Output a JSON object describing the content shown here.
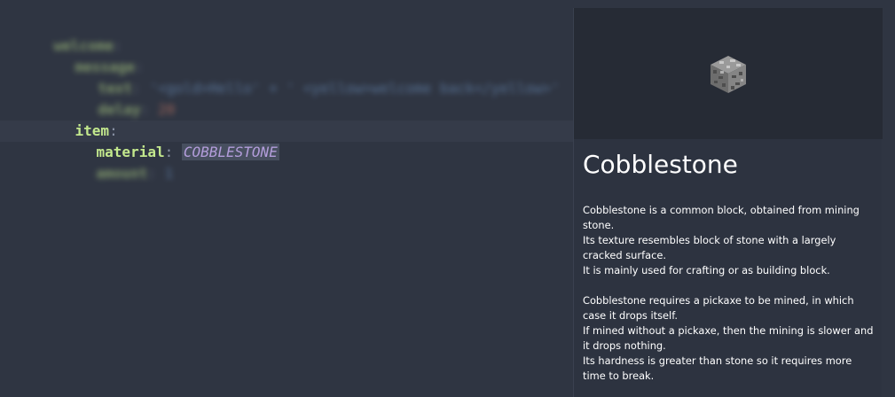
{
  "editor": {
    "blurred_lines": [
      {
        "key": "welcome",
        "indent": 1
      },
      {
        "key": "message",
        "indent": 2
      },
      {
        "key": "text",
        "indent": 3,
        "value": "'<gold>Hello' + ' <yellow>welcome back</yellow>'"
      },
      {
        "key": "delay",
        "indent": 3,
        "value": "20"
      }
    ],
    "item_key": "item",
    "material_key": "material",
    "material_value": "COBBLESTONE",
    "amount_key": "amount",
    "amount_value": "1"
  },
  "popup": {
    "title": "Cobblestone",
    "image_icon": "cobblestone-block-icon",
    "paragraphs": [
      "Cobblestone is a common block, obtained from mining stone.",
      " Its texture resembles block of stone with a largely cracked surface.",
      " It is mainly used for crafting or as building block.",
      "",
      "Cobblestone requires a pickaxe to be mined, in which case it drops itself.",
      " If mined without a pickaxe, then the mining is slower and it drops nothing.",
      " Its hardness is greater than stone so it requires more time to break."
    ]
  },
  "colors": {
    "background": "#2f3542",
    "key": "#c3e88d",
    "enum_value": "#b39ddb",
    "popup_bg": "#2d3340",
    "preview_bg": "#262b35"
  }
}
